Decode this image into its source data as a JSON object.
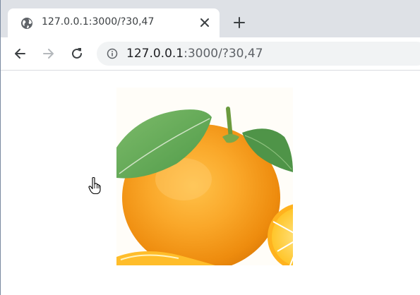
{
  "browser": {
    "tab": {
      "favicon": "globe-icon",
      "title": "127.0.0.1:3000/?30,47",
      "close": "close-icon"
    },
    "new_tab": "plus-icon",
    "toolbar": {
      "back": "arrow-left-icon",
      "forward": "arrow-right-icon",
      "reload": "reload-icon",
      "site_info": "info-icon",
      "url_host": "127.0.0.1",
      "url_rest": ":3000/?30,47"
    }
  },
  "page": {
    "image": "orange-fruit-illustration",
    "cursor": "hand-pointer-icon"
  },
  "colors": {
    "tabstrip": "#dee1e6",
    "omnibox": "#f1f3f4",
    "orange": "#f6a01a",
    "leaf": "#6aab5a"
  }
}
